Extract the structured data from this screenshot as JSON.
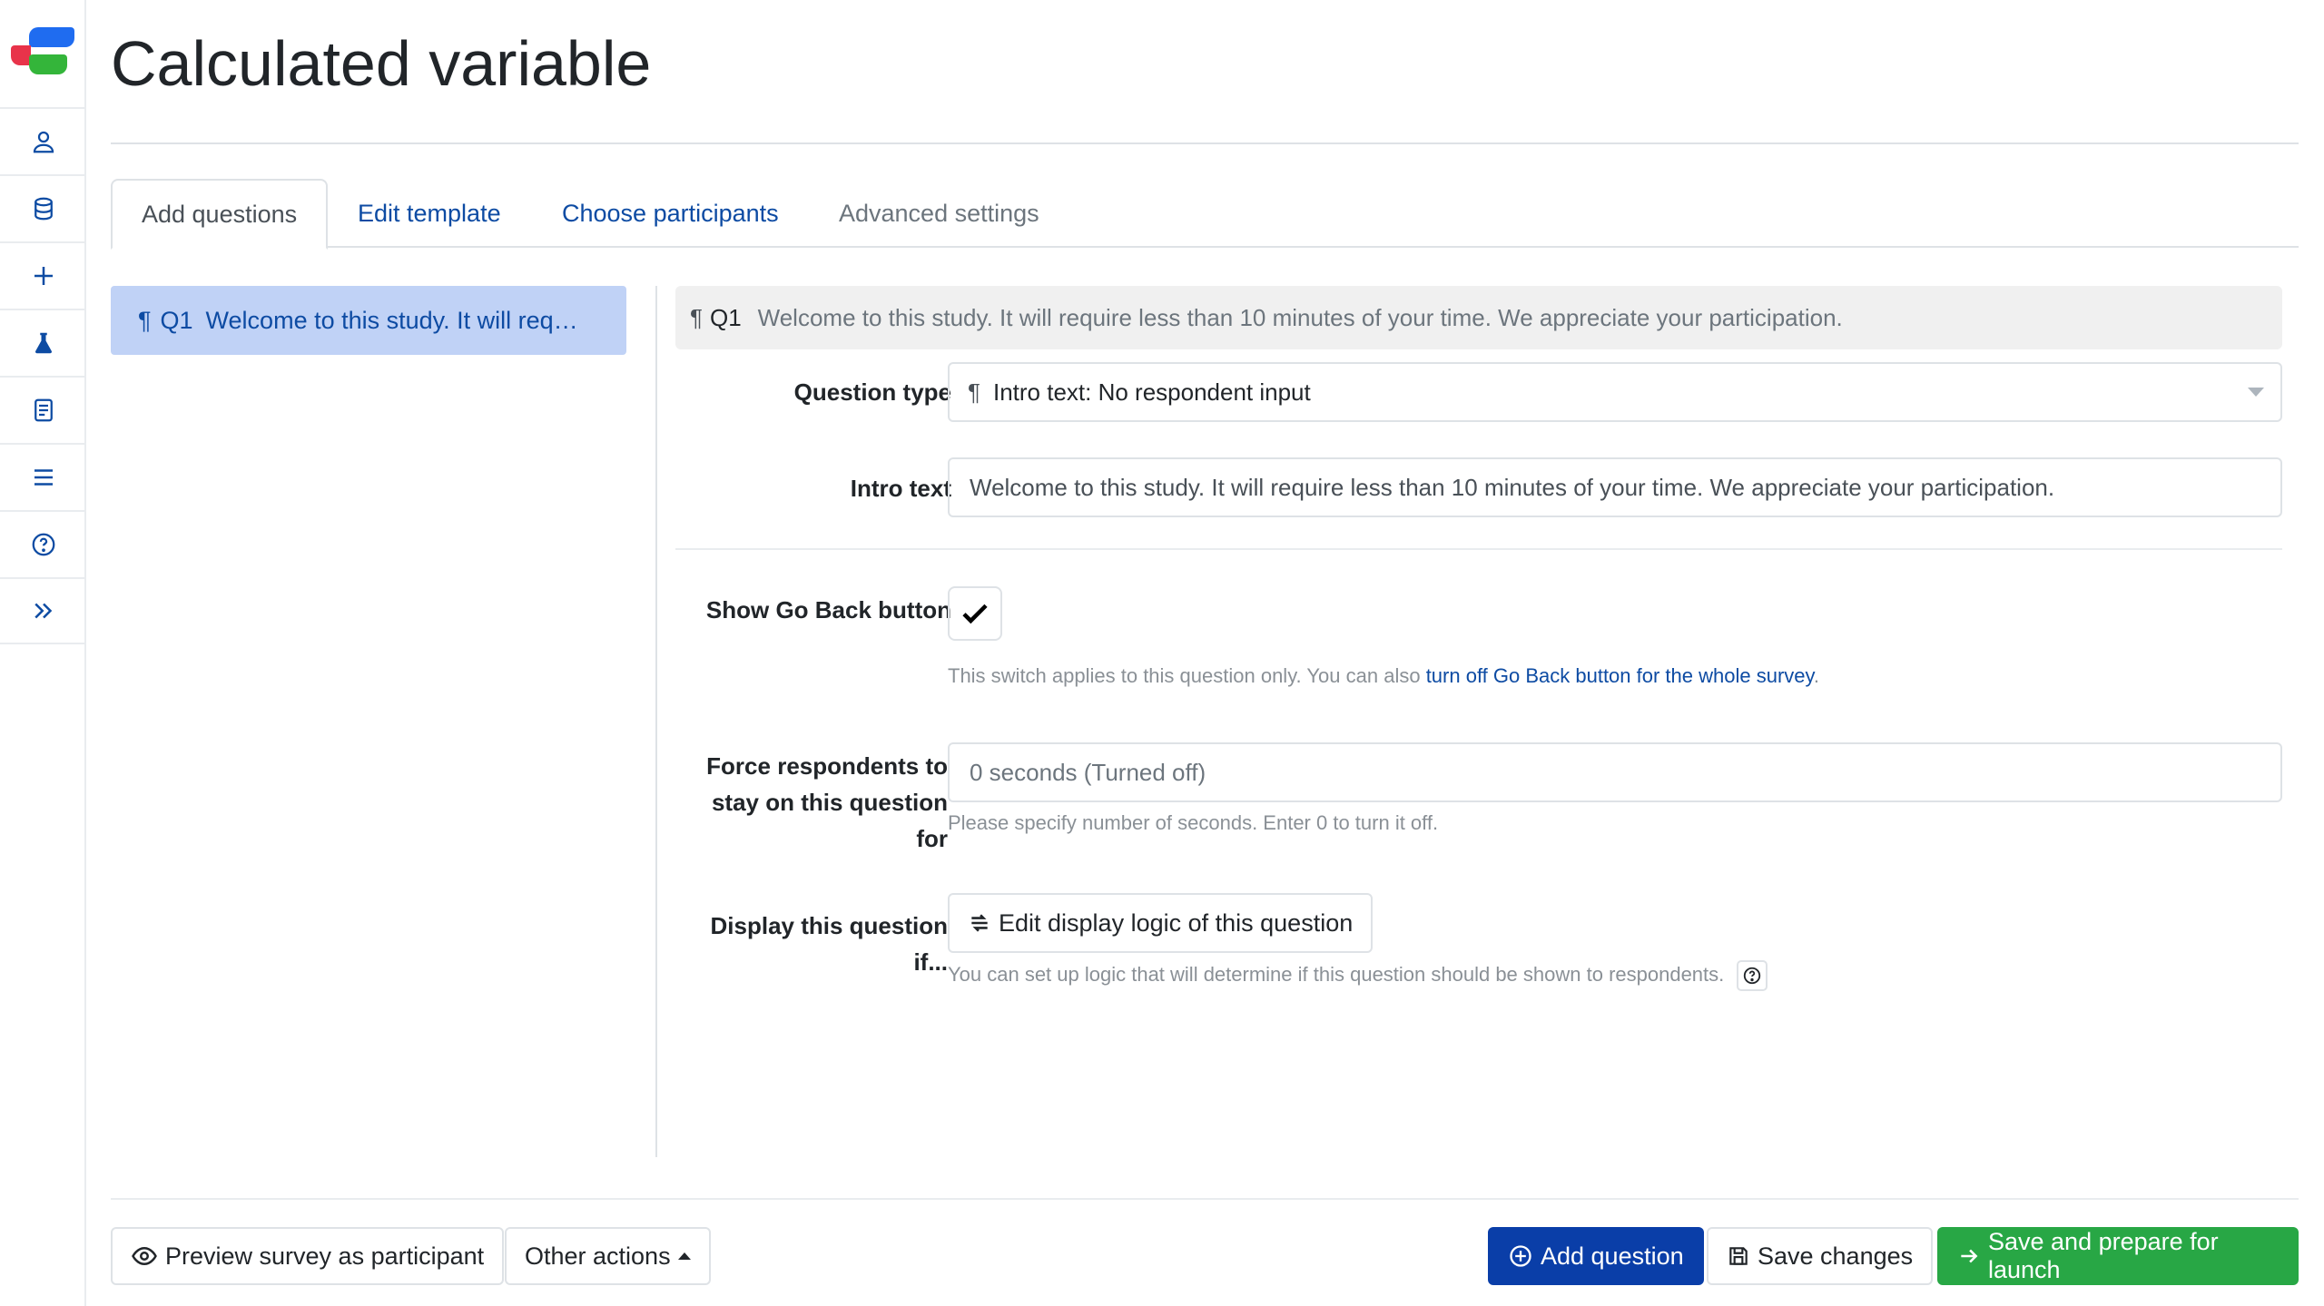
{
  "page": {
    "title": "Calculated variable"
  },
  "sidebar": {
    "icons": [
      "user-icon",
      "database-icon",
      "plus-icon",
      "flask-icon",
      "book-icon",
      "list-icon",
      "help-icon",
      "expand-icon"
    ]
  },
  "tabs": [
    {
      "label": "Add questions"
    },
    {
      "label": "Edit template"
    },
    {
      "label": "Choose participants"
    },
    {
      "label": "Advanced settings"
    }
  ],
  "question_list": [
    {
      "number": "Q1",
      "text": "Welcome to this study. It will req…"
    }
  ],
  "question": {
    "number": "Q1",
    "header_text": "Welcome to this study. It will require less than 10 minutes of your time. We appreciate your participation.",
    "question_type_label": "Question type",
    "question_type_value": "Intro text: No respondent input",
    "intro_text_label": "Intro text",
    "intro_text_value": "Welcome to this study. It will require less than 10 minutes of your time. We appreciate your participation.",
    "go_back_label": "Show Go Back button",
    "go_back_checked": true,
    "go_back_help": "This switch applies to this question only. You can also ",
    "go_back_link": "turn off Go Back button for the whole survey",
    "go_back_help_end": ".",
    "force_label_1": "Force respondents to",
    "force_label_2": "stay on this question",
    "force_label_3": "for",
    "force_placeholder": "0 seconds (Turned off)",
    "force_help": "Please specify number of seconds. Enter 0 to turn it off.",
    "display_label_1": "Display this question",
    "display_label_2": "if...",
    "display_button": "Edit display logic of this question",
    "display_help": "You can set up logic that will determine if this question should be shown to respondents."
  },
  "footer": {
    "preview": "Preview survey as participant",
    "other_actions": "Other actions",
    "add_question": "Add question",
    "save_changes": "Save changes",
    "save_launch": "Save and prepare for launch"
  },
  "colors": {
    "primary": "#0a3ea8",
    "success": "#28a745",
    "link": "#0d4ba3",
    "selected_item": "#c0d2f6"
  }
}
